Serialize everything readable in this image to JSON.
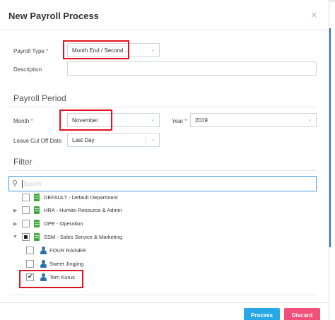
{
  "dialog": {
    "title": "New Payroll Process",
    "close_glyph": "×"
  },
  "payroll_type": {
    "label": "Payroll Type",
    "required_mark": "*",
    "value": "Month End / Second ..."
  },
  "description": {
    "label": "Description",
    "value": ""
  },
  "payroll_period": {
    "heading": "Payroll Period",
    "month": {
      "label": "Month",
      "required_mark": "*",
      "value": "November"
    },
    "year": {
      "label": "Year",
      "required_mark": "*",
      "value": "2019"
    },
    "leave_cutoff": {
      "label": "Leave Cut Off Date",
      "value": "Last Day"
    }
  },
  "filter": {
    "heading": "Filter",
    "search_placeholder": "Search",
    "tree": [
      {
        "label": "DEFAULT - Default Department",
        "type": "department",
        "checked": "none",
        "expander": ""
      },
      {
        "label": "HRA - Human Resource & Admin",
        "type": "department",
        "checked": "none",
        "expander": "collapsed"
      },
      {
        "label": "OPE - Operation",
        "type": "department",
        "checked": "none",
        "expander": "collapsed"
      },
      {
        "label": "SSM - Sales Service & Marketing",
        "type": "department",
        "checked": "partial",
        "expander": "expanded"
      },
      {
        "label": "FOUR RAINER",
        "type": "employee",
        "checked": "none"
      },
      {
        "label": "Sweet Jingjing",
        "type": "employee",
        "checked": "none"
      },
      {
        "label": "Tom Kurus",
        "type": "employee",
        "checked": "checked"
      }
    ]
  },
  "footer": {
    "process_label": "Process",
    "discard_label": "Discard"
  },
  "colors": {
    "process": "#27a7e8",
    "discard": "#f0507a",
    "highlight": "#e0141e",
    "department_icon": "#3dab3d",
    "employee_icon": "#2d6fa8",
    "focus_border": "#4a9fe0"
  }
}
